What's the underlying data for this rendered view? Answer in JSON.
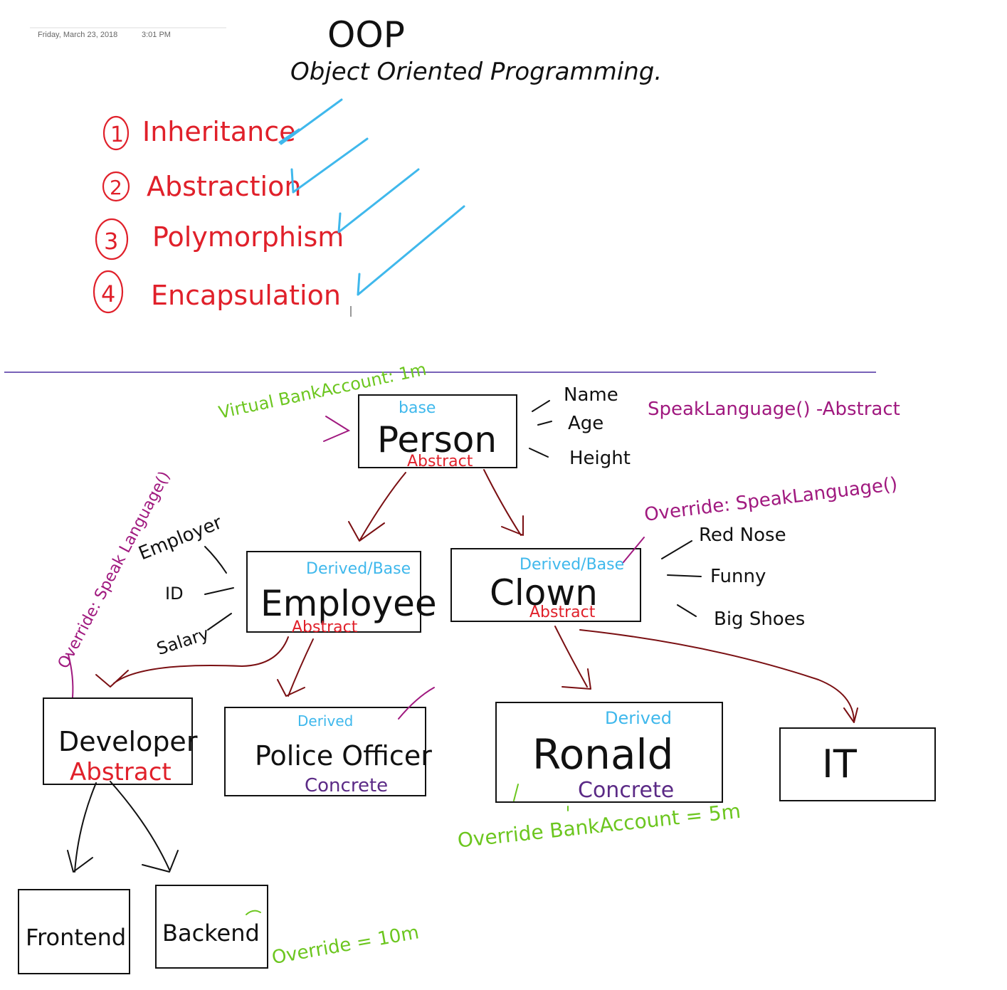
{
  "header": {
    "date": "Friday, March 23, 2018",
    "time": "3:01 PM"
  },
  "title": {
    "main": "OOP",
    "subtitle": "Object Oriented Programming."
  },
  "pillars": [
    {
      "number": "1",
      "label": "Inheritance"
    },
    {
      "number": "2",
      "label": "Abstraction"
    },
    {
      "number": "3",
      "label": "Polymorphism"
    },
    {
      "number": "4",
      "label": "Encapsulation"
    }
  ],
  "diagram": {
    "person": {
      "name": "Person",
      "tag_top": "base",
      "tag_bottom": "Abstract"
    },
    "person_props": [
      "Name",
      "Age",
      "Height"
    ],
    "person_method": "SpeakLanguage() -Abstract",
    "person_virtual": "Virtual BankAccount: 1m",
    "employee": {
      "name": "Employee",
      "tag_top": "Derived/Base",
      "tag_bottom": "Abstract"
    },
    "employee_props": [
      "Employer",
      "ID",
      "Salary"
    ],
    "employee_override": "Override: Speak Language()",
    "clown": {
      "name": "Clown",
      "tag_top": "Derived/Base",
      "tag_bottom": "Abstract"
    },
    "clown_props": [
      "Red Nose",
      "Funny",
      "Big Shoes"
    ],
    "clown_override": "Override: SpeakLanguage()",
    "developer": {
      "name": "Developer",
      "tag_bottom": "Abstract"
    },
    "police": {
      "name": "Police Officer",
      "tag_top": "Derived",
      "tag_bottom": "Concrete"
    },
    "ronald": {
      "name": "Ronald",
      "tag_top": "Derived",
      "tag_bottom": "Concrete"
    },
    "ronald_override": "Override BankAccount = 5m",
    "it": {
      "name": "IT"
    },
    "frontend": {
      "name": "Frontend"
    },
    "backend": {
      "name": "Backend"
    },
    "backend_override": "Override = 10m"
  },
  "colors": {
    "black_ink": "#111111",
    "red_ink": "#e0202a",
    "blue_ink": "#3fb8ec",
    "purple_ink": "#5b2a86",
    "magenta_ink": "#a0197f",
    "green_ink": "#6cc61f",
    "arrow_ink": "#7a0f12",
    "divider": "#4b2fa0"
  }
}
